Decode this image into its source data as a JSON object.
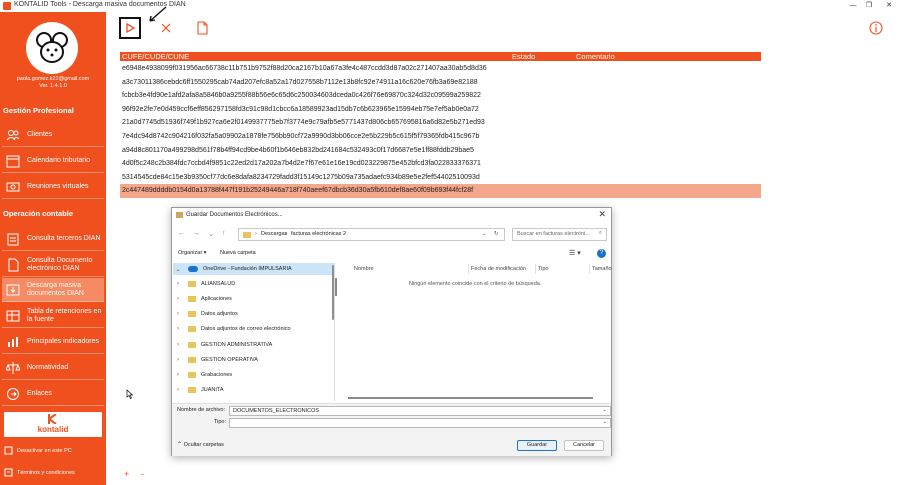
{
  "window": {
    "title": "KONTALID Tools - Descarga masiva documentos DIAN",
    "buttons": [
      "—",
      "❐",
      "✕"
    ]
  },
  "user": {
    "email": "paola.gomez.k21@gmail.com",
    "version": "Ver. 1.4.1.0"
  },
  "sidebar": {
    "section1": "Gestión Profesional",
    "section2": "Operación contable",
    "items": [
      {
        "label": "Clientes",
        "icon": "users-icon"
      },
      {
        "label": "Calendario tributario",
        "icon": "calendar-icon"
      },
      {
        "label": "Reuniones virtuales",
        "icon": "video-icon"
      },
      {
        "label": "Consulta terceros DIAN",
        "icon": "clipboard-icon"
      },
      {
        "label": "Consulta Documento electrónico DIAN",
        "icon": "document-icon"
      },
      {
        "label": "Descarga masiva documentos DIAN",
        "icon": "download-icon"
      },
      {
        "label": "Tabla de retenciones en la fuente",
        "icon": "table-icon"
      },
      {
        "label": "Principales indicadores",
        "icon": "chart-icon"
      },
      {
        "label": "Normatividad",
        "icon": "law-icon"
      },
      {
        "label": "Enlaces",
        "icon": "link-icon"
      }
    ],
    "logo_text": "kontalid",
    "footer": [
      "Desactivar en este PC",
      "Términos y condiciones"
    ]
  },
  "toolbar": {
    "icons": [
      "play-icon",
      "cancel-icon",
      "file-icon",
      "info-icon"
    ]
  },
  "table": {
    "columns": [
      "CUFE/CUDE/CUNE",
      "Estado",
      "Comentario"
    ],
    "rows": [
      "e6948e4938099f031956ac66738c11b751b9752f88d20ca2167b10a67a3fe4c487ccdd3d87a02c271407aa30ab5d8d36",
      "a3c73011386cebdc6ff1550295cab74ad207efc8a52a17d027558b7112e13b8fc92e74911a16c620e76fb3a69e82188",
      "fcbcb3e4fd90e1afd2afa8a5846b0a9255f88b56e6c65d6c250034603dceda0c426f76e69870c324d32c09599a259822",
      "96f92e2fe7e0d459ccf6eff856297158fd3c91c98d1cbcc6a18589923ad15db7c6b623965e15994eb75e7ef5ab0e0a72",
      "21a0d7745d51936f749f1b927ca6e2f0149937775eb7f3774e9c79afb5e5771437d806cb657695816a6d82e5b271ed93",
      "7e4dc94d8742c904216f032fa5a09902a1878fe756bb90cf72a9990d3bb06cce2e5b229b5c615f5f79365fdb415c967b",
      "a94d8c801170a499298d561f78b4ff94cd9be4b60f1b646eb832bd241684c532493c0f17d6687e5e1ff88fddb29bae5",
      "4d0f5c248c2b384fdc7ccbd4f9851c22ed2d17a202a7b4d2e7f67e61e16e19cd023229875e452bfcd3fa022833376371",
      "5314545cde84c15e3b9350cf77dc6e8dafa8234729fadd3f15149c1275b09a735adaefc934b89e5e2fef54402510093d",
      "2c447489ddddb0154d0a13788f447f191b25249446a718f740aeef67dbcb36d30a5fb610def8ae60f09b693f44fcf28f"
    ],
    "selected_index": 9
  },
  "dialog": {
    "title": "Guardar Documentos Electrónicos...",
    "path": [
      "Descargas",
      "facturas electrónicas 2"
    ],
    "search_placeholder": "Buscar en facturas electróni...",
    "organize": "Organizar ▾",
    "new_folder": "Nueva carpeta",
    "tree": [
      "OneDrive - Fundación IMPULSARIA",
      "ALIANSALUD",
      "Aplicaciones",
      "Datos adjuntos",
      "Datos adjuntos de correo electrónico",
      "GESTION ADMINISTRATIVA",
      "GESTION OPERATIVA",
      "Grabaciones",
      "JUANITA"
    ],
    "columns": [
      "Nombre",
      "Fecha de modificación",
      "Tipo",
      "Tamaño"
    ],
    "empty_message": "Ningún elemento coincide con el criterio de búsqueda.",
    "filename_label": "Nombre de archivo:",
    "filename_value": "DOCUMENTOS_ELECTRONICOS",
    "type_label": "Tipo:",
    "type_value": "",
    "hide_folders": "Ocultar carpetas",
    "save": "Guardar",
    "cancel": "Cancelar"
  },
  "footer_controls": [
    "+",
    "-"
  ]
}
